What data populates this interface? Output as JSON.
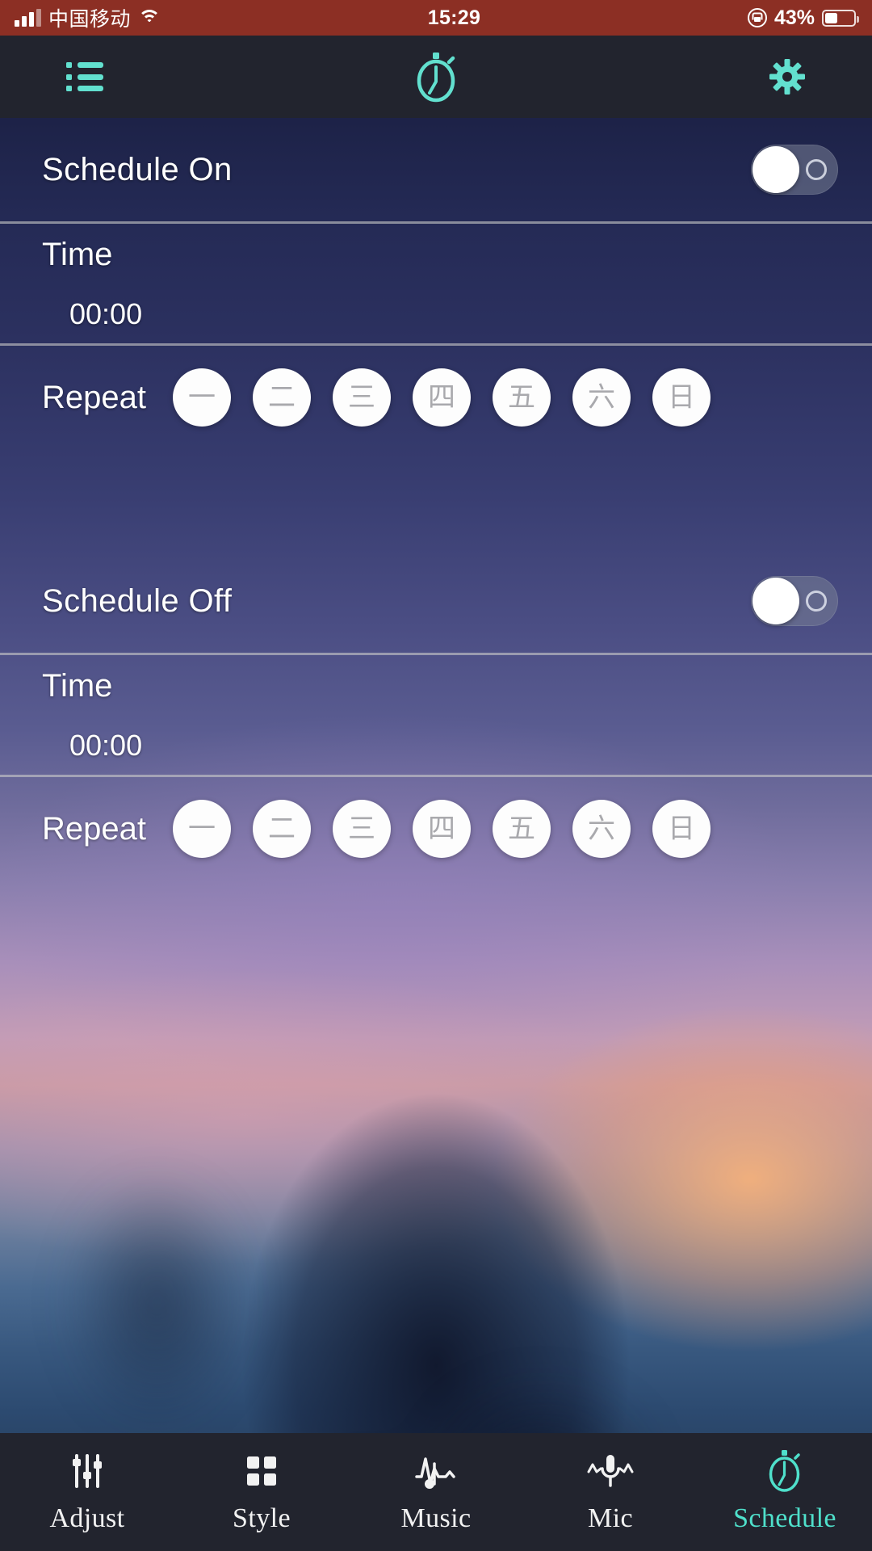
{
  "status_bar": {
    "signal_icon": "cellular-signal-icon",
    "carrier": "中国移动",
    "wifi_icon": "wifi-icon",
    "time": "15:29",
    "rotation_lock_icon": "rotation-lock-icon",
    "battery_percent": "43%",
    "battery_level": 43,
    "background_color": "#8c2f24"
  },
  "nav_bar": {
    "background_color": "#22242e",
    "accent_color": "#62e0cf",
    "left_icon": "list-icon",
    "center_icon": "stopwatch-icon",
    "right_icon": "gear-icon"
  },
  "schedule_on": {
    "label": "Schedule On",
    "enabled": false,
    "time_label": "Time",
    "time_value": "00:00",
    "repeat_label": "Repeat",
    "days": [
      {
        "char": "一",
        "name": "monday",
        "selected": false
      },
      {
        "char": "二",
        "name": "tuesday",
        "selected": false
      },
      {
        "char": "三",
        "name": "wednesday",
        "selected": false
      },
      {
        "char": "四",
        "name": "thursday",
        "selected": false
      },
      {
        "char": "五",
        "name": "friday",
        "selected": false
      },
      {
        "char": "六",
        "name": "saturday",
        "selected": false
      },
      {
        "char": "日",
        "name": "sunday",
        "selected": false
      }
    ]
  },
  "schedule_off": {
    "label": "Schedule Off",
    "enabled": false,
    "time_label": "Time",
    "time_value": "00:00",
    "repeat_label": "Repeat",
    "days": [
      {
        "char": "一",
        "name": "monday",
        "selected": false
      },
      {
        "char": "二",
        "name": "tuesday",
        "selected": false
      },
      {
        "char": "三",
        "name": "wednesday",
        "selected": false
      },
      {
        "char": "四",
        "name": "thursday",
        "selected": false
      },
      {
        "char": "五",
        "name": "friday",
        "selected": false
      },
      {
        "char": "六",
        "name": "saturday",
        "selected": false
      },
      {
        "char": "日",
        "name": "sunday",
        "selected": false
      }
    ]
  },
  "tab_bar": {
    "background_color": "#22242e",
    "active_color": "#4fe0cb",
    "inactive_color": "#f2f2f2",
    "tabs": [
      {
        "label": "Adjust",
        "icon": "sliders-icon",
        "active": false
      },
      {
        "label": "Style",
        "icon": "grid-icon",
        "active": false
      },
      {
        "label": "Music",
        "icon": "music-wave-icon",
        "active": false
      },
      {
        "label": "Mic",
        "icon": "microphone-icon",
        "active": false
      },
      {
        "label": "Schedule",
        "icon": "stopwatch-icon",
        "active": true
      }
    ]
  }
}
